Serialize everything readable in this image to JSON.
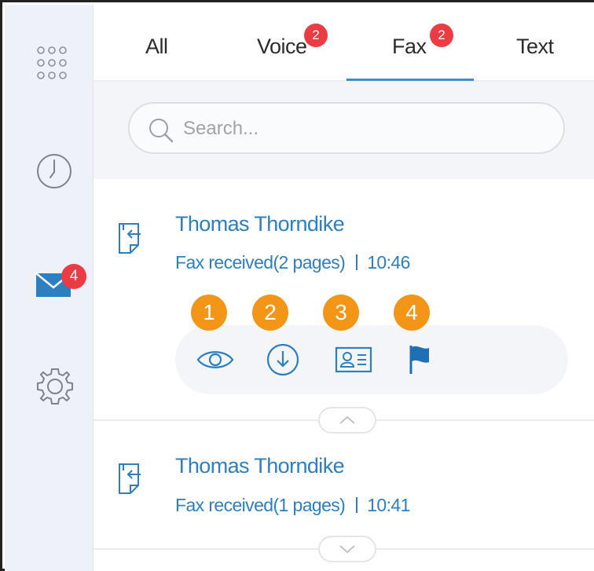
{
  "sidebar": {
    "items": [
      {
        "icon": "apps-grid-icon"
      },
      {
        "icon": "clock-icon"
      },
      {
        "icon": "mail-icon",
        "badge": "4"
      },
      {
        "icon": "gear-icon"
      }
    ]
  },
  "tabs": [
    {
      "label": "All"
    },
    {
      "label": "Voice",
      "badge": "2"
    },
    {
      "label": "Fax",
      "badge": "2",
      "active": true
    },
    {
      "label": "Text"
    }
  ],
  "search": {
    "placeholder": "Search...",
    "value": ""
  },
  "messages": [
    {
      "name": "Thomas Thorndike",
      "status": "Fax received(2 pages)",
      "time": "10:46",
      "expanded": true
    },
    {
      "name": "Thomas Thorndike",
      "status": "Fax received(1 pages)",
      "time": "10:41",
      "expanded": false
    }
  ],
  "actions": [
    {
      "number": "1",
      "icon": "eye-icon"
    },
    {
      "number": "2",
      "icon": "download-icon"
    },
    {
      "number": "3",
      "icon": "contact-card-icon"
    },
    {
      "number": "4",
      "icon": "flag-icon"
    }
  ],
  "colors": {
    "accent": "#2c7fc1",
    "badge": "#ec3b43",
    "callout": "#f39617",
    "sidebar_bg": "#eef2f8"
  }
}
